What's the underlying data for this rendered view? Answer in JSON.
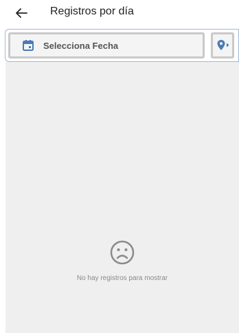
{
  "header": {
    "title": "Registros por día",
    "back_icon": "arrow-left-icon"
  },
  "filter": {
    "date_placeholder": "Selecciona Fecha",
    "calendar_icon": "calendar-icon",
    "location_icon": "location-pin-icon"
  },
  "content": {
    "empty_icon": "sad-face-icon",
    "empty_message": "No hay registros para mostrar"
  },
  "colors": {
    "accent": "#4a7bb5",
    "field_border": "#c9c9c9",
    "content_bg": "#efefef"
  }
}
